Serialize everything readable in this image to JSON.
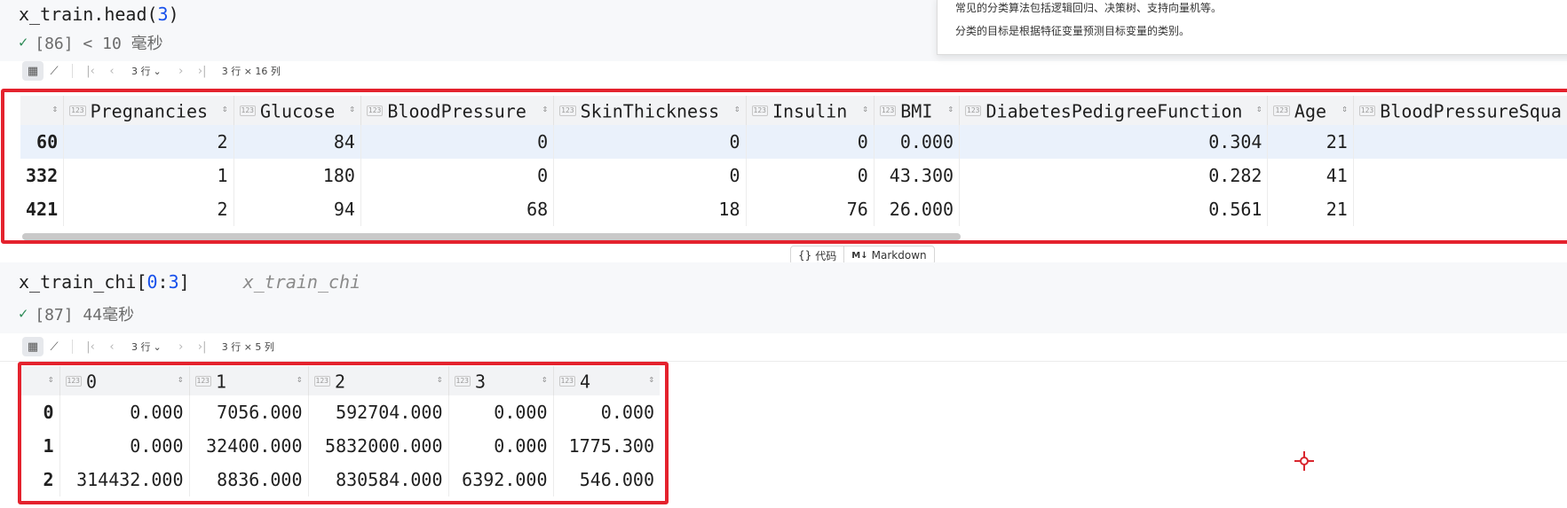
{
  "cell1": {
    "code": "x_train.head(",
    "code_arg": "3",
    "code_close": ")",
    "status": "[86] < 10 毫秒",
    "toolbar": {
      "rows_select": "3 行",
      "shape": "3 行 × 16 列"
    },
    "table": {
      "columns": [
        "Pregnancies",
        "Glucose",
        "BloodPressure",
        "SkinThickness",
        "Insulin",
        "BMI",
        "DiabetesPedigreeFunction",
        "Age",
        "BloodPressureSqua"
      ],
      "rows": [
        {
          "index": "60",
          "values": [
            "2",
            "84",
            "0",
            "0",
            "0",
            "0.000",
            "0.304",
            "21",
            ""
          ]
        },
        {
          "index": "332",
          "values": [
            "1",
            "180",
            "0",
            "0",
            "0",
            "43.300",
            "0.282",
            "41",
            ""
          ]
        },
        {
          "index": "421",
          "values": [
            "2",
            "94",
            "68",
            "18",
            "76",
            "26.000",
            "0.561",
            "21",
            ""
          ]
        }
      ]
    }
  },
  "doc_popup": {
    "line1": "常见的分类算法包括逻辑回归、决策树、支持向量机等。",
    "line2": "分类的目标是根据特征变量预测目标变量的类别。"
  },
  "cell_switch": {
    "code_label": "代码",
    "markdown_label": "Markdown"
  },
  "cell2": {
    "code_name": "x_train_chi[",
    "code_arg1": "0",
    "code_colon": ":",
    "code_arg2": "3",
    "code_close": "]",
    "hint": "x_train_chi",
    "status": "[87] 44毫秒",
    "toolbar": {
      "rows_select": "3 行",
      "shape": "3 行 × 5 列"
    },
    "table": {
      "columns": [
        "0",
        "1",
        "2",
        "3",
        "4"
      ],
      "rows": [
        {
          "index": "0",
          "values": [
            "0.000",
            "7056.000",
            "592704.000",
            "0.000",
            "0.000"
          ]
        },
        {
          "index": "1",
          "values": [
            "0.000",
            "32400.000",
            "5832000.000",
            "0.000",
            "1775.300"
          ]
        },
        {
          "index": "2",
          "values": [
            "314432.000",
            "8836.000",
            "830584.000",
            "6392.000",
            "546.000"
          ]
        }
      ]
    }
  },
  "icons": {
    "type_badge": "123",
    "sort": "sort-arrows-icon",
    "check": "checkmark-icon",
    "crosshair": "crosshair-cursor-icon"
  },
  "colors": {
    "highlight_frame": "#e4222d",
    "number_literal": "#1750eb",
    "success_check": "#2e8b57"
  }
}
